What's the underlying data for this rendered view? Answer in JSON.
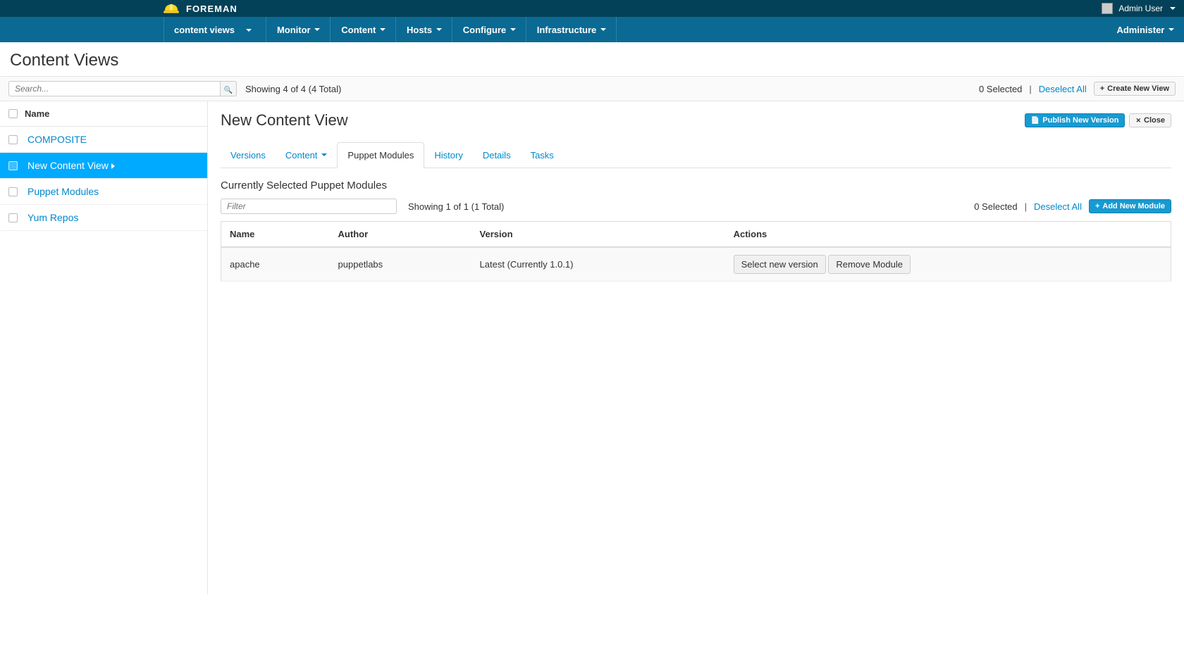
{
  "topbar": {
    "brand": "FOREMAN",
    "user_label": "Admin User"
  },
  "nav": {
    "context": "content views",
    "items": [
      "Monitor",
      "Content",
      "Hosts",
      "Configure",
      "Infrastructure"
    ],
    "admin": "Administer"
  },
  "page": {
    "title": "Content Views"
  },
  "toolbar": {
    "search_placeholder": "Search...",
    "count": "Showing 4 of 4 (4 Total)",
    "selected": "0 Selected",
    "deselect": "Deselect All",
    "create": "Create New View"
  },
  "sidebar": {
    "header": "Name",
    "items": [
      {
        "label": "COMPOSITE",
        "active": false
      },
      {
        "label": "New Content View",
        "active": true
      },
      {
        "label": "Puppet Modules",
        "active": false
      },
      {
        "label": "Yum Repos",
        "active": false
      }
    ]
  },
  "detail": {
    "title": "New Content View",
    "publish": "Publish New Version",
    "close": "Close",
    "tabs": [
      "Versions",
      "Content",
      "Puppet Modules",
      "History",
      "Details",
      "Tasks"
    ],
    "active_tab": "Puppet Modules",
    "section_title": "Currently Selected Puppet Modules",
    "filter_placeholder": "Filter",
    "filter_count": "Showing 1 of 1 (1 Total)",
    "filter_selected": "0 Selected",
    "filter_deselect": "Deselect All",
    "add_module": "Add New Module",
    "table": {
      "headers": [
        "Name",
        "Author",
        "Version",
        "Actions"
      ],
      "rows": [
        {
          "name": "apache",
          "author": "puppetlabs",
          "version": "Latest (Currently 1.0.1)",
          "select_label": "Select new version",
          "remove_label": "Remove Module"
        }
      ]
    }
  }
}
